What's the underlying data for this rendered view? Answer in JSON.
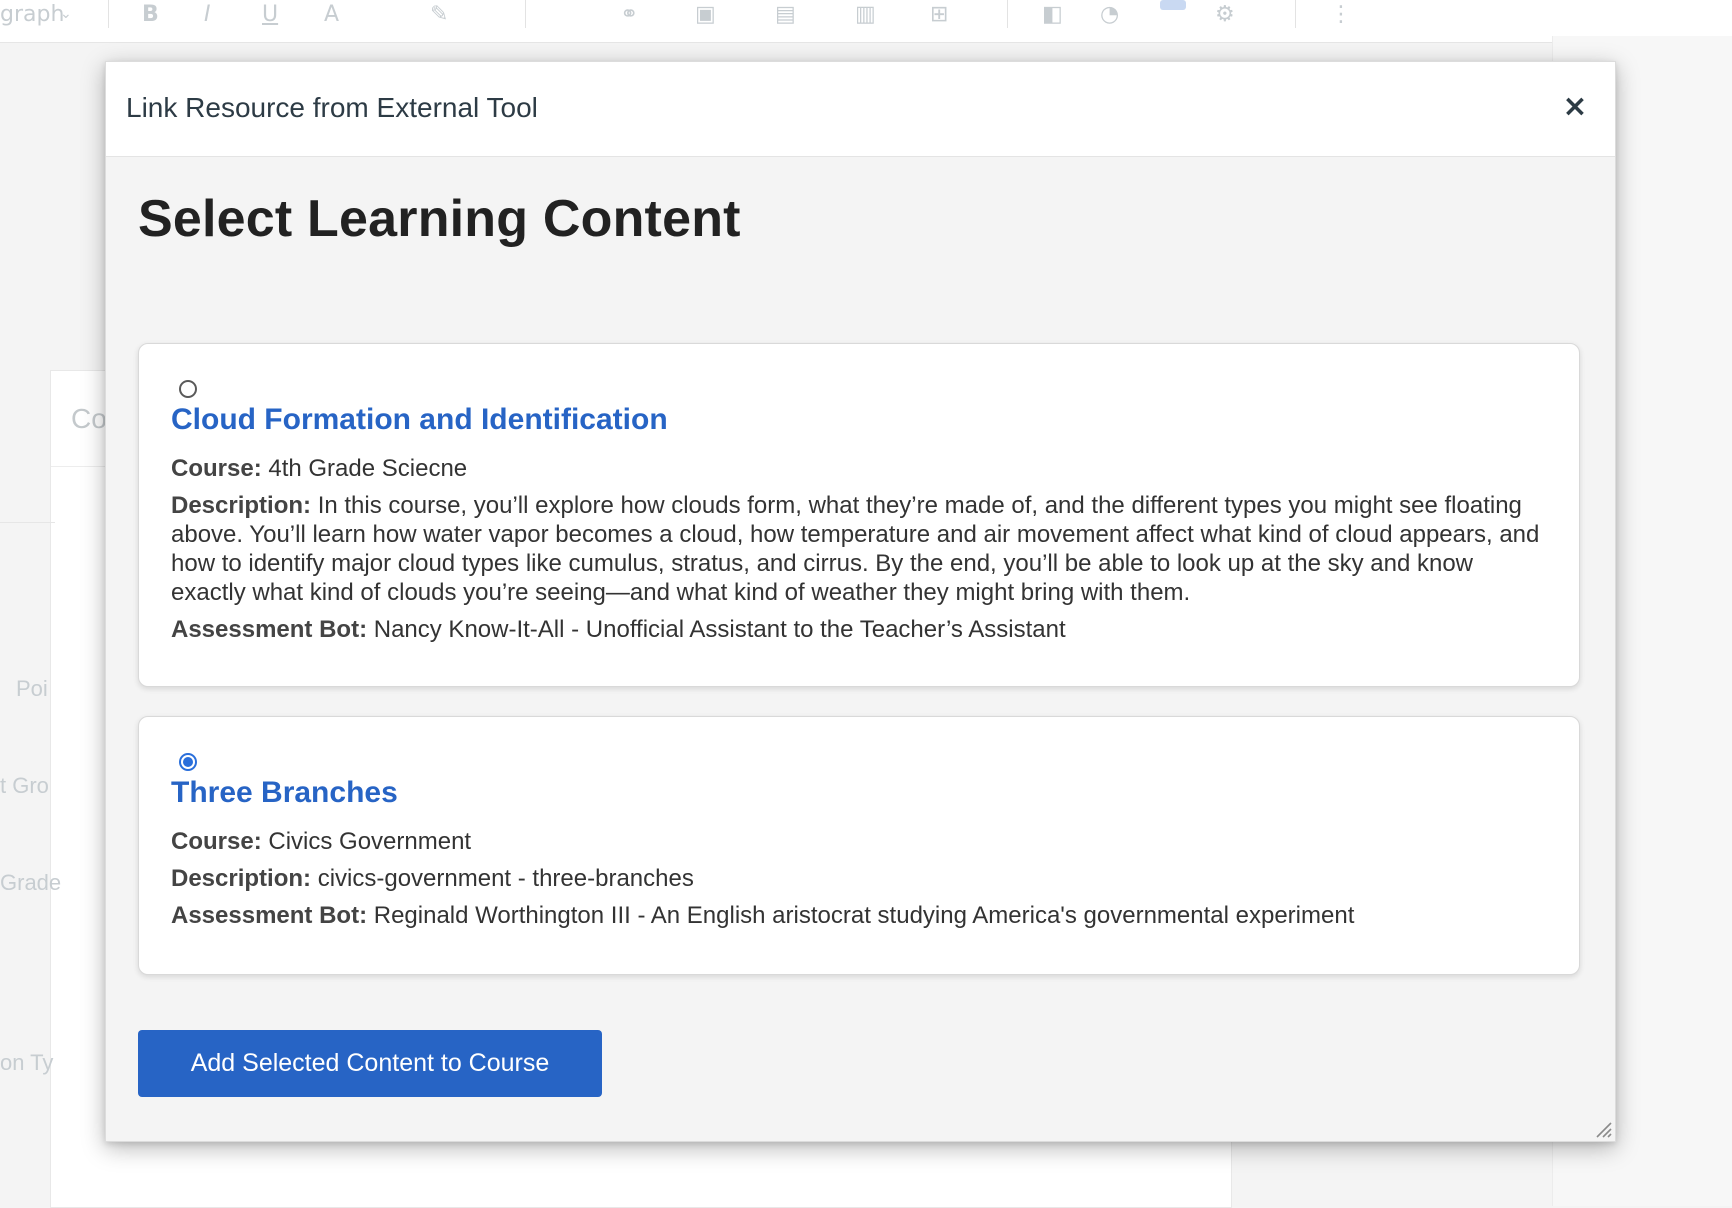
{
  "background": {
    "toolbar_items": [
      "graph",
      "B",
      "I",
      "U",
      "A",
      "⋮"
    ],
    "panel_title": "Co",
    "side_labels": [
      "Poi",
      "t Gro",
      "Grade",
      "on Ty"
    ]
  },
  "modal": {
    "title": "Link Resource from External Tool",
    "close_label": "×",
    "heading": "Select Learning Content",
    "items": [
      {
        "selected": false,
        "title": "Cloud Formation and Identification",
        "course_label": "Course:",
        "course": "4th Grade Sciecne",
        "description_label": "Description:",
        "description": "In this course, you’ll explore how clouds form, what they’re made of, and the different types you might see floating above. You’ll learn how water vapor becomes a cloud, how temperature and air movement affect what kind of cloud appears, and how to identify major cloud types like cumulus, stratus, and cirrus. By the end, you’ll be able to look up at the sky and know exactly what kind of clouds you’re seeing—and what kind of weather they might bring with them.",
        "bot_label": "Assessment Bot:",
        "bot": "Nancy Know-It-All - Unofficial Assistant to the Teacher’s Assistant"
      },
      {
        "selected": true,
        "title": "Three Branches",
        "course_label": "Course:",
        "course": "Civics Government",
        "description_label": "Description:",
        "description": "civics-government - three-branches",
        "bot_label": "Assessment Bot:",
        "bot": "Reginald Worthington III - An English aristocrat studying America's governmental experiment"
      }
    ],
    "submit_label": "Add Selected Content to Course"
  },
  "colors": {
    "accent": "#2764c5",
    "radio_selected": "#2a6fdb"
  }
}
